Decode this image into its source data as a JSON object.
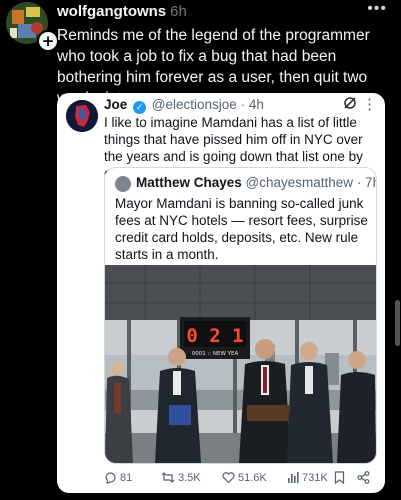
{
  "post": {
    "username": "wolfgangtowns",
    "timestamp": "6h",
    "more_label": "•••",
    "text": "Reminds me of the legend of the programmer who took a job to fix a bug that had been bothering him forever as a user, then quit two weeks later"
  },
  "tweet": {
    "name": "Joe",
    "handle": "@electionsjoe",
    "time": "· 4h",
    "text": "I like to imagine Mamdani has a list of little things that have pissed him off in NYC over the years and is going down that list one by one.",
    "quote": {
      "name": "Matthew Chayes",
      "handle": "@chayesmatthew",
      "time": "· 7h",
      "text": "Mayor Mamdani is banning so-called junk fees at NYC hotels — resort fees, surprise credit card holds, deposits, etc. New rule starts in a month.",
      "photo": {
        "clock_text": "0 2 1",
        "sign_text": "0001 :: NEW YEA"
      }
    },
    "actions": {
      "replies": "81",
      "reposts": "3.5K",
      "likes": "51.6K",
      "views": "731K"
    }
  },
  "icons": [
    "plus-icon",
    "more-icon",
    "verified-icon",
    "grok-icon",
    "reply-icon",
    "repost-icon",
    "like-icon",
    "views-icon",
    "bookmark-icon",
    "share-icon"
  ]
}
